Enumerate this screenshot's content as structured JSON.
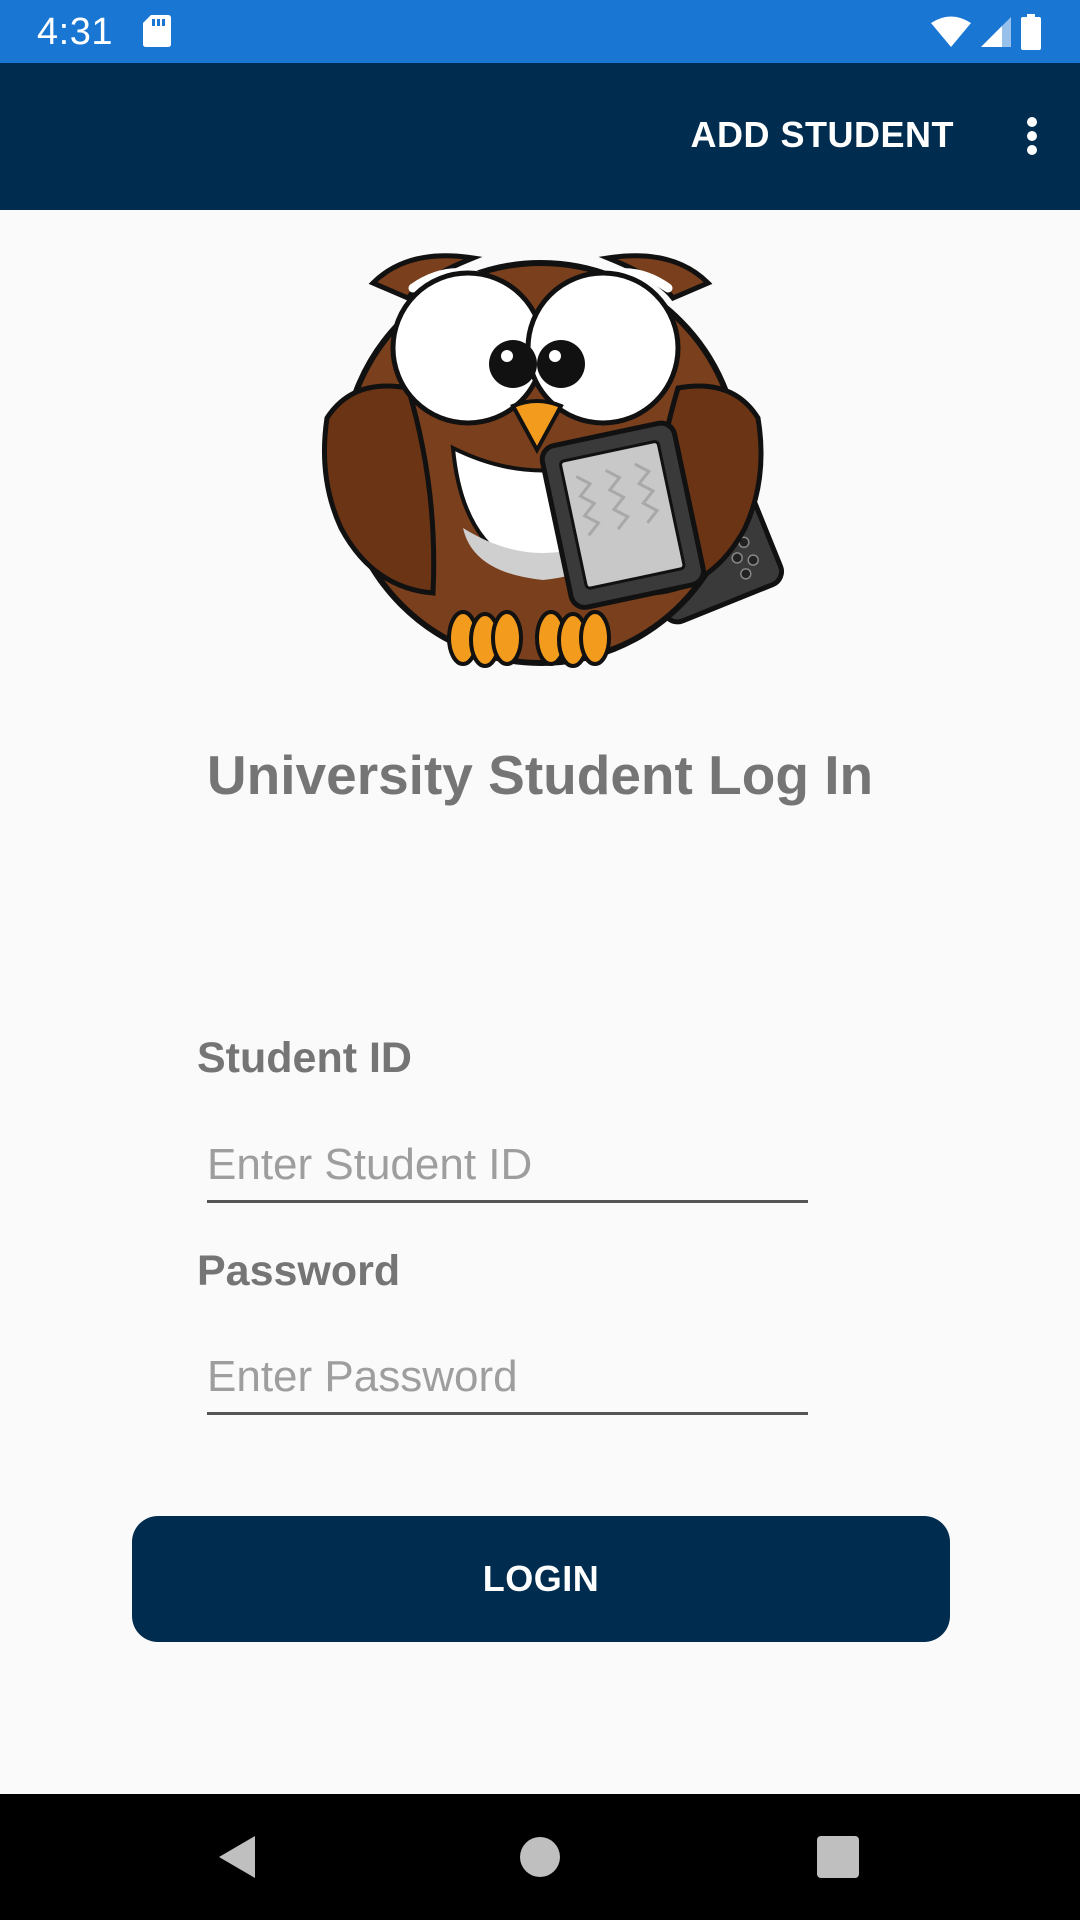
{
  "status_bar": {
    "time": "4:31",
    "icons": [
      "sd-card-icon",
      "wifi-icon",
      "cell-signal-icon",
      "battery-icon"
    ]
  },
  "app_bar": {
    "action_label": "ADD STUDENT",
    "menu_icon": "more-vert-icon"
  },
  "logo": {
    "icon": "owl-with-tablet-illustration"
  },
  "title": "University Student Log In",
  "form": {
    "student_id_label": "Student ID",
    "student_id_placeholder": "Enter Student ID",
    "student_id_value": "",
    "password_label": "Password",
    "password_placeholder": "Enter Password",
    "password_value": ""
  },
  "login_button": "LOGIN",
  "nav_bar": {
    "icons": [
      "back-icon",
      "home-icon",
      "recents-icon"
    ]
  },
  "colors": {
    "status_bar": "#1976d2",
    "app_bar": "#002d4f",
    "button": "#002d4f",
    "label_text": "#757575",
    "background": "#fafafa"
  }
}
